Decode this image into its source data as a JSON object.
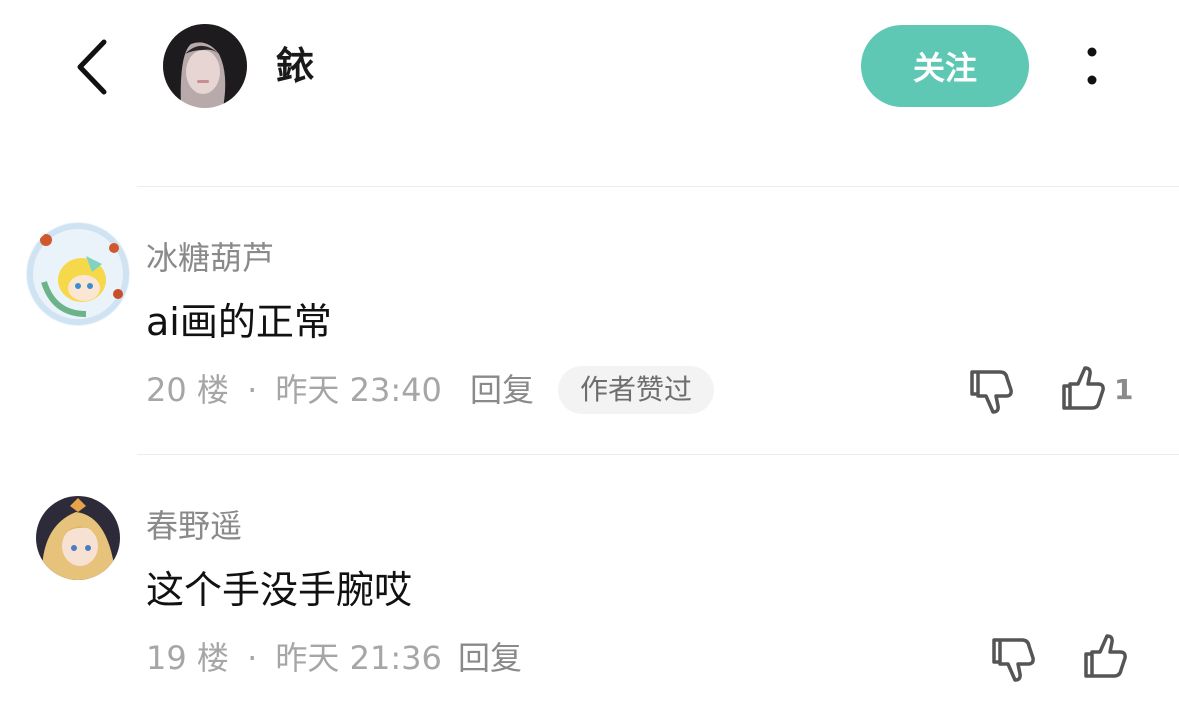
{
  "header": {
    "back_icon": "chevron-left-icon",
    "author_name": "銥",
    "follow_label": "关注",
    "more_icon": "more-vertical-icon",
    "follow_color": "#5ec8b5"
  },
  "comments": [
    {
      "username": "冰糖葫芦",
      "text": "ai画的正常",
      "floor": "20 楼",
      "separator": "·",
      "time": "昨天 23:40",
      "reply_label": "回复",
      "badge": "作者赞过",
      "like_count": "1"
    },
    {
      "username": "春野遥",
      "text": "这个手没手腕哎",
      "floor": "19 楼",
      "separator": "·",
      "time": "昨天 21:36",
      "reply_label": "回复",
      "badge": "",
      "like_count": ""
    }
  ],
  "icons": {
    "dislike": "thumbs-down-icon",
    "like": "thumbs-up-icon"
  }
}
